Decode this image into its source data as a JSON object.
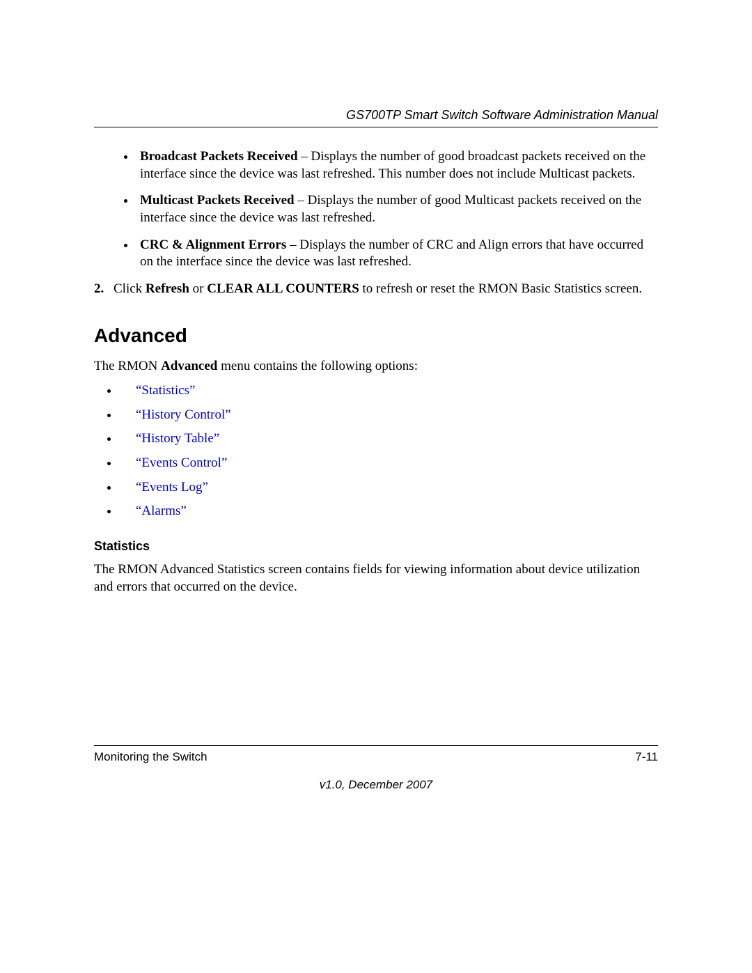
{
  "header": {
    "title": "GS700TP Smart Switch Software Administration Manual"
  },
  "bullets": {
    "b1_term": "Broadcast Packets Received",
    "b1_desc": " – Displays the number of good broadcast packets received on the interface since the device was last refreshed. This number does not include Multicast packets.",
    "b2_term": "Multicast Packets Received",
    "b2_desc": " – Displays the number of good Multicast packets received on the interface since the device was last refreshed.",
    "b3_term": "CRC & Alignment Errors",
    "b3_desc": " – Displays the number of CRC and Align errors that have occurred on the interface since the device was last refreshed."
  },
  "step2": {
    "num": "2.",
    "pre": "Click ",
    "refresh": "Refresh",
    "mid": " or ",
    "clear": "CLEAR ALL COUNTERS",
    "post": " to refresh or reset the RMON Basic Statistics screen."
  },
  "advanced": {
    "heading": "Advanced",
    "intro_pre": "The RMON ",
    "intro_bold": "Advanced",
    "intro_post": " menu contains the following options:",
    "links": {
      "l1": "“Statistics”",
      "l2": "“History Control”",
      "l3": "“History Table”",
      "l4": "“Events Control”",
      "l5": "“Events Log”",
      "l6": "“Alarms”"
    }
  },
  "statistics": {
    "heading": "Statistics",
    "para": "The RMON Advanced Statistics screen contains fields for viewing information about device utilization and errors that occurred on the device."
  },
  "footer": {
    "left": "Monitoring the Switch",
    "right": "7-11",
    "version": "v1.0, December 2007"
  }
}
